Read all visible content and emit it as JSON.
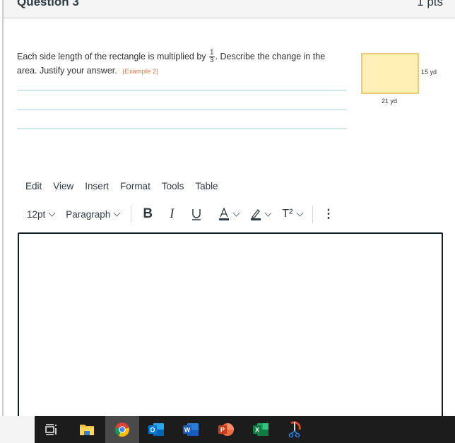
{
  "question": {
    "title": "Question 3",
    "points": "1 pts",
    "text_before": "Each side length of the rectangle is multiplied by",
    "fraction": {
      "numerator": "1",
      "denominator": "3"
    },
    "text_after": ". Describe the change in the area. Justify your answer.",
    "example_ref": "(Example 2)",
    "figure": {
      "height_label": "15 yd",
      "width_label": "21 yd",
      "fill_color": "#fff0b8",
      "stroke_color": "#e8c978"
    }
  },
  "editor": {
    "menu": [
      "Edit",
      "View",
      "Insert",
      "Format",
      "Tools",
      "Table"
    ],
    "toolbar": {
      "font_size": "12pt",
      "block_format": "Paragraph",
      "bold": "B",
      "italic": "I",
      "underline": "U",
      "text_color": "A",
      "superscript": "T²",
      "more": "⋮"
    },
    "content": ""
  },
  "taskbar": {
    "apps": [
      {
        "name": "Task View",
        "icon": "task-view-icon"
      },
      {
        "name": "File Explorer",
        "icon": "folder-icon"
      },
      {
        "name": "Google Chrome",
        "icon": "chrome-icon",
        "active": true
      },
      {
        "name": "Outlook",
        "icon": "outlook-icon",
        "letter": "O"
      },
      {
        "name": "Word",
        "icon": "word-icon",
        "letter": "W"
      },
      {
        "name": "PowerPoint",
        "icon": "powerpoint-icon",
        "letter": "P"
      },
      {
        "name": "Excel",
        "icon": "excel-icon",
        "letter": "X"
      },
      {
        "name": "Snipping Tool",
        "icon": "snipping-tool-icon"
      }
    ]
  }
}
